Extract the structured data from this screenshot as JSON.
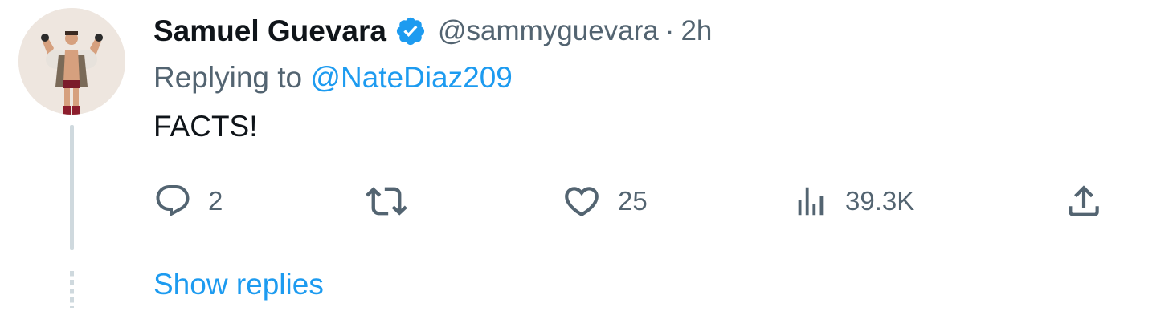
{
  "tweet": {
    "display_name": "Samuel Guevara",
    "handle": "@sammyguevara",
    "separator": "·",
    "time": "2h",
    "replying_prefix": "Replying to",
    "replying_to": "@NateDiaz209",
    "text": "FACTS!",
    "verified_color": "#1d9bf0"
  },
  "actions": {
    "reply_count": "2",
    "retweet_count": "",
    "like_count": "25",
    "views_count": "39.3K"
  },
  "thread": {
    "show_replies_label": "Show replies"
  },
  "icons": {
    "avatar": "profile-photo",
    "verified": "verified-badge-icon",
    "reply": "reply-icon",
    "retweet": "retweet-icon",
    "like": "heart-icon",
    "views": "views-icon",
    "share": "share-icon"
  },
  "colors": {
    "text": "#0f1419",
    "muted": "#536471",
    "link": "#1d9bf0",
    "thread_line": "#cfd9de"
  }
}
